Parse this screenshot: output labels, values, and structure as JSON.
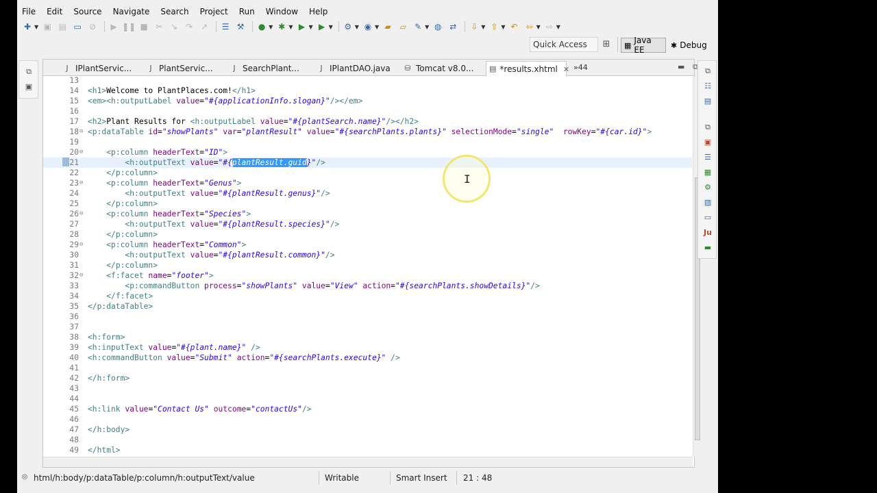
{
  "menu": [
    "File",
    "Edit",
    "Source",
    "Navigate",
    "Search",
    "Project",
    "Run",
    "Window",
    "Help"
  ],
  "quick_access": "Quick Access",
  "perspectives": {
    "active": "Java EE",
    "other": "Debug"
  },
  "tabs": [
    {
      "label": "IPlantServic...",
      "icon": "java-file-icon",
      "active": false
    },
    {
      "label": "PlantServic...",
      "icon": "java-file-icon",
      "active": false
    },
    {
      "label": "SearchPlant...",
      "icon": "java-file-icon",
      "active": false
    },
    {
      "label": "IPlantDAO.java",
      "icon": "java-file-icon",
      "active": false
    },
    {
      "label": "Tomcat v8.0...",
      "icon": "server-icon",
      "active": false
    },
    {
      "label": "*results.xhtml",
      "icon": "xhtml-file-icon",
      "active": true
    }
  ],
  "tab_overflow": "»44",
  "code": {
    "current_line": 21,
    "lines": [
      {
        "n": "13",
        "fold": "",
        "s": []
      },
      {
        "n": "14",
        "fold": "",
        "s": [
          [
            "t",
            "<h1>"
          ],
          [
            "tx",
            "Welcome to PlantPlaces.com!"
          ],
          [
            "t",
            "</h1>"
          ]
        ]
      },
      {
        "n": "15",
        "fold": "",
        "s": [
          [
            "t",
            "<em><h:outputLabel "
          ],
          [
            "a",
            "value"
          ],
          [
            "tx",
            "="
          ],
          [
            "v",
            "\"#{applicationInfo.slogan}\""
          ],
          [
            "t",
            "/></em>"
          ]
        ]
      },
      {
        "n": "16",
        "fold": "",
        "s": []
      },
      {
        "n": "17",
        "fold": "",
        "s": [
          [
            "t",
            "<h2>"
          ],
          [
            "tx",
            "Plant Results for "
          ],
          [
            "t",
            "<h:outputLabel "
          ],
          [
            "a",
            "value"
          ],
          [
            "tx",
            "="
          ],
          [
            "v",
            "\"#{plantSearch.name}\""
          ],
          [
            "t",
            "/></h2>"
          ]
        ]
      },
      {
        "n": "18",
        "fold": "⊖",
        "s": [
          [
            "t",
            "<p:dataTable "
          ],
          [
            "a",
            "id"
          ],
          [
            "tx",
            "="
          ],
          [
            "v",
            "\"showPlants\""
          ],
          [
            "tx",
            " "
          ],
          [
            "a",
            "var"
          ],
          [
            "tx",
            "="
          ],
          [
            "v",
            "\"plantResult\""
          ],
          [
            "tx",
            " "
          ],
          [
            "a",
            "value"
          ],
          [
            "tx",
            "="
          ],
          [
            "v",
            "\"#{searchPlants.plants}\""
          ],
          [
            "tx",
            " "
          ],
          [
            "a",
            "selectionMode"
          ],
          [
            "tx",
            "="
          ],
          [
            "v",
            "\"single\""
          ],
          [
            "tx",
            "  "
          ],
          [
            "a",
            "rowKey"
          ],
          [
            "tx",
            "="
          ],
          [
            "v",
            "\"#{car.id}\""
          ],
          [
            "t",
            ">"
          ]
        ]
      },
      {
        "n": "19",
        "fold": "",
        "s": []
      },
      {
        "n": "20",
        "fold": "⊖",
        "s": [
          [
            "tx",
            "    "
          ],
          [
            "t",
            "<p:column "
          ],
          [
            "a",
            "headerText"
          ],
          [
            "tx",
            "="
          ],
          [
            "v",
            "\"ID\""
          ],
          [
            "t",
            ">"
          ]
        ]
      },
      {
        "n": "21",
        "fold": "",
        "s": [
          [
            "tx",
            "        "
          ],
          [
            "t",
            "<h:outputText "
          ],
          [
            "a",
            "value"
          ],
          [
            "tx",
            "="
          ],
          [
            "v",
            "\"#{"
          ],
          [
            "sel",
            "plantResult.guid"
          ],
          [
            "v",
            "}\""
          ],
          [
            "t",
            "/>"
          ]
        ]
      },
      {
        "n": "22",
        "fold": "",
        "s": [
          [
            "tx",
            "    "
          ],
          [
            "t",
            "</p:column>"
          ]
        ]
      },
      {
        "n": "23",
        "fold": "⊖",
        "s": [
          [
            "tx",
            "    "
          ],
          [
            "t",
            "<p:column "
          ],
          [
            "a",
            "headerText"
          ],
          [
            "tx",
            "="
          ],
          [
            "v",
            "\"Genus\""
          ],
          [
            "t",
            ">"
          ]
        ]
      },
      {
        "n": "24",
        "fold": "",
        "s": [
          [
            "tx",
            "        "
          ],
          [
            "t",
            "<h:outputText "
          ],
          [
            "a",
            "value"
          ],
          [
            "tx",
            "="
          ],
          [
            "v",
            "\"#{plantResult.genus}\""
          ],
          [
            "t",
            "/>"
          ]
        ]
      },
      {
        "n": "25",
        "fold": "",
        "s": [
          [
            "tx",
            "    "
          ],
          [
            "t",
            "</p:column>"
          ]
        ]
      },
      {
        "n": "26",
        "fold": "⊖",
        "s": [
          [
            "tx",
            "    "
          ],
          [
            "t",
            "<p:column "
          ],
          [
            "a",
            "headerText"
          ],
          [
            "tx",
            "="
          ],
          [
            "v",
            "\"Species\""
          ],
          [
            "t",
            ">"
          ]
        ]
      },
      {
        "n": "27",
        "fold": "",
        "s": [
          [
            "tx",
            "        "
          ],
          [
            "t",
            "<h:outputText "
          ],
          [
            "a",
            "value"
          ],
          [
            "tx",
            "="
          ],
          [
            "v",
            "\"#{plantResult.species}\""
          ],
          [
            "t",
            "/>"
          ]
        ]
      },
      {
        "n": "28",
        "fold": "",
        "s": [
          [
            "tx",
            "    "
          ],
          [
            "t",
            "</p:column>"
          ]
        ]
      },
      {
        "n": "29",
        "fold": "⊖",
        "s": [
          [
            "tx",
            "    "
          ],
          [
            "t",
            "<p:column "
          ],
          [
            "a",
            "headerText"
          ],
          [
            "tx",
            "="
          ],
          [
            "v",
            "\"Common\""
          ],
          [
            "t",
            ">"
          ]
        ]
      },
      {
        "n": "30",
        "fold": "",
        "s": [
          [
            "tx",
            "        "
          ],
          [
            "t",
            "<h:outputText "
          ],
          [
            "a",
            "value"
          ],
          [
            "tx",
            "="
          ],
          [
            "v",
            "\"#{plantResult.common}\""
          ],
          [
            "t",
            "/>"
          ]
        ]
      },
      {
        "n": "31",
        "fold": "",
        "s": [
          [
            "tx",
            "    "
          ],
          [
            "t",
            "</p:column>"
          ]
        ]
      },
      {
        "n": "32",
        "fold": "⊖",
        "s": [
          [
            "tx",
            "    "
          ],
          [
            "t",
            "<f:facet "
          ],
          [
            "a",
            "name"
          ],
          [
            "tx",
            "="
          ],
          [
            "v",
            "\"footer\""
          ],
          [
            "t",
            ">"
          ]
        ]
      },
      {
        "n": "33",
        "fold": "",
        "s": [
          [
            "tx",
            "        "
          ],
          [
            "t",
            "<p:commandButton "
          ],
          [
            "a",
            "process"
          ],
          [
            "tx",
            "="
          ],
          [
            "v",
            "\"showPlants\""
          ],
          [
            "tx",
            " "
          ],
          [
            "a",
            "value"
          ],
          [
            "tx",
            "="
          ],
          [
            "v",
            "\"View\""
          ],
          [
            "tx",
            " "
          ],
          [
            "a",
            "action"
          ],
          [
            "tx",
            "="
          ],
          [
            "v",
            "\"#{searchPlants.showDetails}\""
          ],
          [
            "t",
            "/>"
          ]
        ]
      },
      {
        "n": "34",
        "fold": "",
        "s": [
          [
            "tx",
            "    "
          ],
          [
            "t",
            "</f:facet>"
          ]
        ]
      },
      {
        "n": "35",
        "fold": "",
        "s": [
          [
            "t",
            "</p:dataTable>"
          ]
        ]
      },
      {
        "n": "36",
        "fold": "",
        "s": []
      },
      {
        "n": "37",
        "fold": "",
        "s": []
      },
      {
        "n": "38",
        "fold": "",
        "s": [
          [
            "t",
            "<h:form>"
          ]
        ]
      },
      {
        "n": "39",
        "fold": "",
        "s": [
          [
            "t",
            "<h:inputText "
          ],
          [
            "a",
            "value"
          ],
          [
            "tx",
            "="
          ],
          [
            "v",
            "\"#{plant.name}\""
          ],
          [
            "tx",
            " "
          ],
          [
            "t",
            "/>"
          ]
        ]
      },
      {
        "n": "40",
        "fold": "",
        "s": [
          [
            "t",
            "<h:commandButton "
          ],
          [
            "a",
            "value"
          ],
          [
            "tx",
            "="
          ],
          [
            "v",
            "\"Submit\""
          ],
          [
            "tx",
            " "
          ],
          [
            "a",
            "action"
          ],
          [
            "tx",
            "="
          ],
          [
            "v",
            "\"#{searchPlants.execute}\""
          ],
          [
            "tx",
            " "
          ],
          [
            "t",
            "/>"
          ]
        ]
      },
      {
        "n": "41",
        "fold": "",
        "s": []
      },
      {
        "n": "42",
        "fold": "",
        "s": [
          [
            "t",
            "</h:form>"
          ]
        ]
      },
      {
        "n": "43",
        "fold": "",
        "s": []
      },
      {
        "n": "44",
        "fold": "",
        "s": []
      },
      {
        "n": "45",
        "fold": "",
        "s": [
          [
            "t",
            "<h:link "
          ],
          [
            "a",
            "value"
          ],
          [
            "tx",
            "="
          ],
          [
            "v",
            "\"Contact Us\""
          ],
          [
            "tx",
            " "
          ],
          [
            "a",
            "outcome"
          ],
          [
            "tx",
            "="
          ],
          [
            "v",
            "\"contactUs\""
          ],
          [
            "t",
            "/>"
          ]
        ]
      },
      {
        "n": "46",
        "fold": "",
        "s": []
      },
      {
        "n": "47",
        "fold": "",
        "s": [
          [
            "t",
            "</h:body>"
          ]
        ]
      },
      {
        "n": "48",
        "fold": "",
        "s": []
      },
      {
        "n": "49",
        "fold": "",
        "s": [
          [
            "t",
            "</html>"
          ]
        ]
      }
    ]
  },
  "status": {
    "path": "html/h:body/p:dataTable/p:column/h:outputText/value",
    "mode": "Writable",
    "insert": "Smart Insert",
    "position": "21 : 48"
  },
  "colors": {
    "tag": "#3f7f7f",
    "attribute": "#7f007f",
    "value": "#2a00ff",
    "selection": "#3399ff",
    "current_line": "#e8f2fe"
  }
}
